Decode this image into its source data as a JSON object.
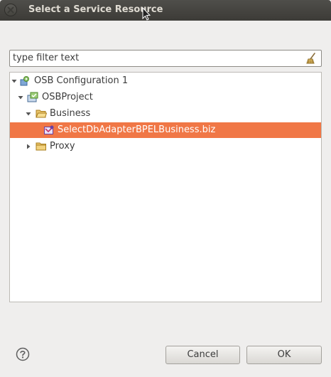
{
  "window": {
    "title": "Select a Service Resource"
  },
  "filter": {
    "value": "type filter text"
  },
  "tree": {
    "items": [
      {
        "label": "OSB Configuration 1",
        "icon": "osb-configuration-icon",
        "expanded": true
      },
      {
        "label": "OSBProject",
        "icon": "project-icon",
        "expanded": true
      },
      {
        "label": "Business",
        "icon": "folder-open-icon",
        "expanded": true
      },
      {
        "label": "SelectDbAdapterBPELBusiness.biz",
        "icon": "business-service-icon",
        "selected": true
      },
      {
        "label": "Proxy",
        "icon": "folder-icon",
        "expanded": false
      }
    ]
  },
  "buttons": {
    "cancel": "Cancel",
    "ok": "OK"
  },
  "colors": {
    "selection": "#f07746",
    "titlebar": "#3c3b37",
    "dialog_bg": "#efeeed"
  }
}
